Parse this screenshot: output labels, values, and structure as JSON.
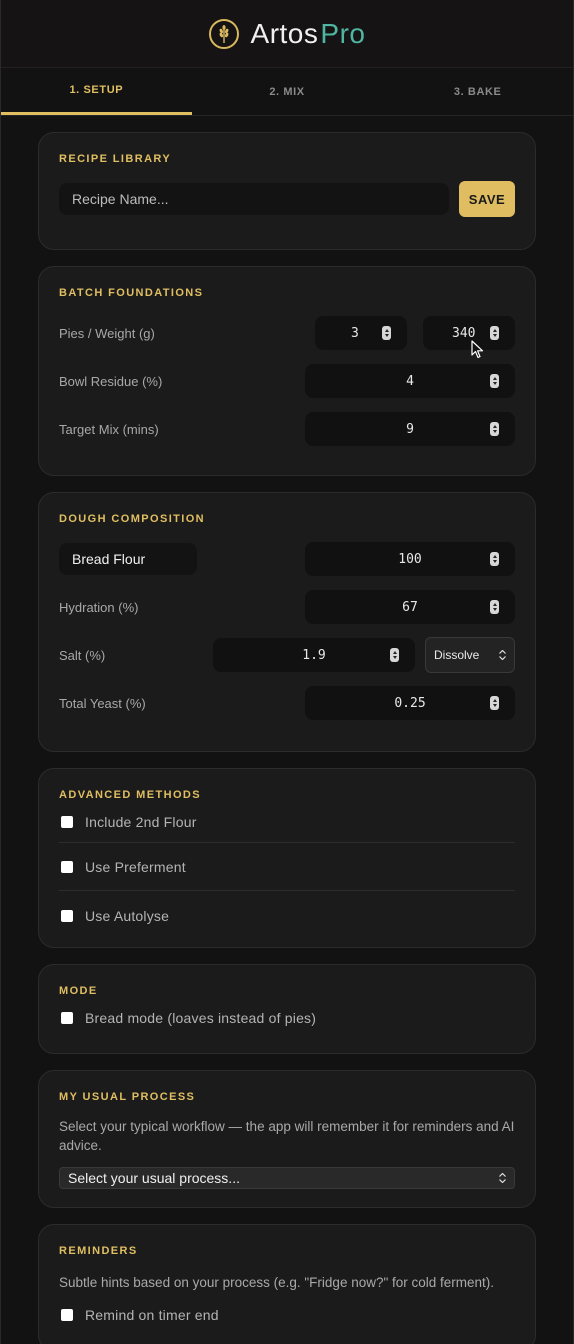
{
  "app": {
    "brand_main": "Artos",
    "brand_accent": "Pro",
    "logo_icon": "wheat-icon"
  },
  "tabs": [
    {
      "label": "1. SETUP",
      "active": true
    },
    {
      "label": "2. MIX",
      "active": false
    },
    {
      "label": "3. BAKE",
      "active": false
    }
  ],
  "recipe_library": {
    "title": "RECIPE LIBRARY",
    "name_placeholder": "Recipe Name...",
    "save_label": "SAVE"
  },
  "batch": {
    "title": "BATCH FOUNDATIONS",
    "pies_label": "Pies / Weight (g)",
    "pies_value": "3",
    "weight_value": "340",
    "residue_label": "Bowl Residue (%)",
    "residue_value": "4",
    "mix_label": "Target Mix (mins)",
    "mix_value": "9"
  },
  "dough": {
    "title": "DOUGH COMPOSITION",
    "flour_name": "Bread Flour",
    "flour_value": "100",
    "hydration_label": "Hydration (%)",
    "hydration_value": "67",
    "salt_label": "Salt (%)",
    "salt_value": "1.9",
    "salt_method": "Dissolve",
    "yeast_label": "Total Yeast (%)",
    "yeast_value": "0.25"
  },
  "advanced": {
    "title": "ADVANCED METHODS",
    "options": [
      {
        "label": "Include 2nd Flour",
        "checked": false
      },
      {
        "label": "Use Preferment",
        "checked": false
      },
      {
        "label": "Use Autolyse",
        "checked": false
      }
    ]
  },
  "mode": {
    "title": "MODE",
    "bread_label": "Bread mode (loaves instead of pies)",
    "checked": false
  },
  "process": {
    "title": "MY USUAL PROCESS",
    "description": "Select your typical workflow — the app will remember it for reminders and AI advice.",
    "selected": "Select your usual process..."
  },
  "reminders": {
    "title": "REMINDERS",
    "description": "Subtle hints based on your process (e.g. \"Fridge now?\" for cold ferment).",
    "timer_label": "Remind on timer end"
  },
  "colors": {
    "accent": "#e0bf62",
    "teal": "#4fb6a1",
    "background": "#131212",
    "card": "#1c1b1b"
  }
}
